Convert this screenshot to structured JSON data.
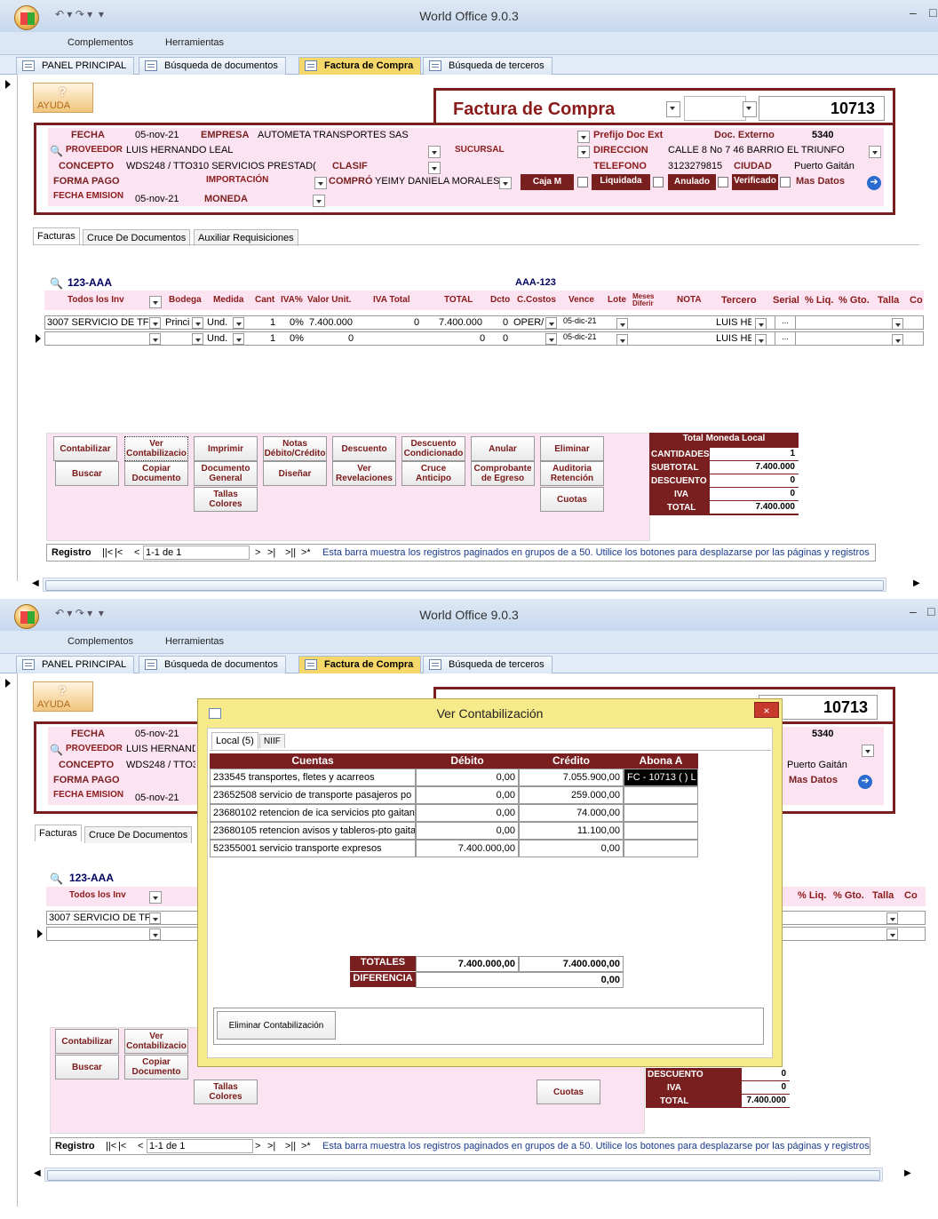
{
  "app": {
    "title": "World Office 9.0.3",
    "min": "–",
    "max": "□"
  },
  "ribbon": {
    "items": [
      "Complementos",
      "Herramientas"
    ]
  },
  "tabs": [
    "PANEL PRINCIPAL",
    "Búsqueda de documentos",
    "Factura de Compra",
    "Búsqueda de terceros"
  ],
  "help": {
    "label": "AYUDA",
    "symbol": "?"
  },
  "doc": {
    "title": "Factura de Compra",
    "number": "10713",
    "prefijo_label": "Prefijo Doc Ext",
    "externo_label": "Doc. Externo",
    "externo_value": "5340",
    "fecha_label": "FECHA",
    "fecha": "05-nov-21",
    "empresa_label": "EMPRESA",
    "empresa": "AUTOMETA TRANSPORTES SAS",
    "proveedor_label": "PROVEEDOR",
    "proveedor": "LUIS HERNANDO LEAL",
    "sucursal_label": "SUCURSAL",
    "direccion_label": "DIRECCION",
    "direccion": "CALLE 8 No 7 46 BARRIO EL TRIUNFO",
    "concepto_label": "CONCEPTO",
    "concepto": "WDS248 / TTO310 SERVICIOS PRESTAD(",
    "clasif_label": "CLASIF",
    "telefono_label": "TELEFONO",
    "telefono": "3123279815",
    "ciudad_label": "CIUDAD",
    "ciudad": "Puerto Gaitán",
    "formapago_label": "FORMA PAGO",
    "importacion_label": "IMPORTACIÓN",
    "compro_label": "COMPRÓ",
    "compro": "YEIMY DANIELA MORALES",
    "cajam_label": "Caja M",
    "liquidada_label": "Liquidada",
    "anulado_label": "Anulado",
    "verificado_label": "Verificado",
    "masdatos_label": "Mas Datos",
    "fechaemision_label": "FECHA EMISION",
    "fechaemision": "05-nov-21",
    "moneda_label": "MONEDA"
  },
  "subtabs": [
    "Facturas",
    "Cruce De Documentos",
    "Auxiliar Requisiciones"
  ],
  "grid": {
    "code_left": "123-AAA",
    "code_right": "AAA-123",
    "headers": [
      "Todos los Inv",
      "Bodega",
      "Medida",
      "Cant",
      "IVA%",
      "Valor Unit.",
      "IVA Total",
      "TOTAL",
      "Dcto",
      "C.Costos",
      "Vence",
      "Lote",
      "Meses Diferir",
      "NOTA",
      "Tercero",
      "Serial",
      "% Liq.",
      "% Gto.",
      "Talla",
      "Co"
    ],
    "rows": [
      {
        "item": "3007 SERVICIO DE TF",
        "bodega": "Princi",
        "medida": "Und.",
        "cant": "1",
        "iva": "0%",
        "valor": "7.400.000",
        "ivatotal": "0",
        "total": "7.400.000",
        "dcto": "0",
        "ccostos": "OPER/",
        "vence": "05-dic-21",
        "tercero": "LUIS HE",
        "serial": "..."
      },
      {
        "item": "",
        "bodega": "",
        "medida": "Und.",
        "cant": "1",
        "iva": "0%",
        "valor": "0",
        "ivatotal": "",
        "total": "0",
        "dcto": "0",
        "ccostos": "",
        "vence": "05-dic-21",
        "tercero": "LUIS HE",
        "serial": "..."
      }
    ]
  },
  "buttons": {
    "contabilizar": "Contabilizar",
    "ver_contabilizacion": "Ver Contabilizacio",
    "imprimir": "Imprimir",
    "notas": "Notas Débito/Crédito",
    "descuento": "Descuento",
    "descuento_cond": "Descuento Condicionado",
    "anular": "Anular",
    "eliminar": "Eliminar",
    "buscar": "Buscar",
    "copiar": "Copiar Documento",
    "doc_general": "Documento General",
    "disenar": "Diseñar",
    "ver_revelaciones": "Ver Revelaciones",
    "cruce_anticipo": "Cruce Anticipo",
    "comprobante_egreso": "Comprobante de Egreso",
    "auditoria": "Auditoria Retención",
    "tallas": "Tallas Colores",
    "cuotas": "Cuotas"
  },
  "totals": {
    "title": "Total Moneda Local",
    "rows": [
      {
        "label": "CANTIDADES",
        "value": "1"
      },
      {
        "label": "SUBTOTAL",
        "value": "7.400.000"
      },
      {
        "label": "DESCUENTO",
        "value": "0"
      },
      {
        "label": "IVA",
        "value": "0"
      },
      {
        "label": "TOTAL",
        "value": "7.400.000"
      }
    ]
  },
  "nav": {
    "registro": "Registro",
    "first": "||<",
    "prev": "|<",
    "prev2": "<",
    "record": "1-1 de 1",
    "next": ">",
    "last": ">|",
    "lastpage": ">||",
    "new": ">*",
    "message": "Esta barra muestra los registros paginados en grupos de a 50. Utilice los botones para desplazarse por las páginas y registros"
  },
  "dialog": {
    "title": "Ver Contabilización",
    "close": "×",
    "tabs": [
      "Local (5)",
      "NIIF"
    ],
    "headers": [
      "Cuentas",
      "Débito",
      "Crédito",
      "Abona A"
    ],
    "rows": [
      {
        "cuenta": "233545 transportes, fletes y acarreos",
        "debito": "0,00",
        "credito": "7.055.900,00",
        "abona": "FC - 10713 ( ) L"
      },
      {
        "cuenta": "23652508 servicio de transporte pasajeros po",
        "debito": "0,00",
        "credito": "259.000,00",
        "abona": ""
      },
      {
        "cuenta": "23680102 retencion de ica servicios pto gaitan",
        "debito": "0,00",
        "credito": "74.000,00",
        "abona": ""
      },
      {
        "cuenta": "23680105 retencion avisos y tableros-pto gaita",
        "debito": "0,00",
        "credito": "11.100,00",
        "abona": ""
      },
      {
        "cuenta": "52355001 servicio transporte expresos",
        "debito": "7.400.000,00",
        "credito": "0,00",
        "abona": ""
      }
    ],
    "totales_label": "TOTALES",
    "totales_debito": "7.400.000,00",
    "totales_credito": "7.400.000,00",
    "diferencia_label": "DIFERENCIA",
    "diferencia": "0,00",
    "eliminar": "Eliminar Contabilización"
  },
  "colors": {
    "brand": "#7a1f1f",
    "pink": "#fbe3f1",
    "dialog": "#f6ea8a"
  }
}
